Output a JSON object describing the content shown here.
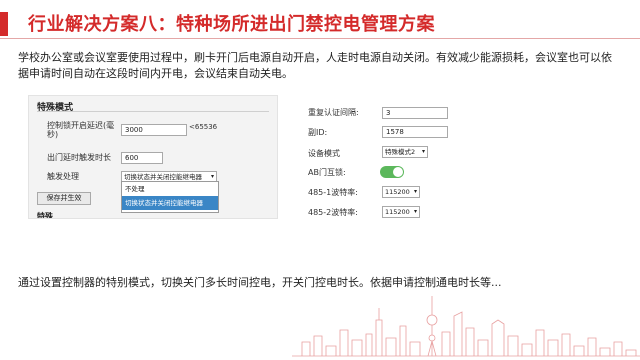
{
  "header": {
    "title": "行业解决方案八：特种场所进出门禁控电管理方案"
  },
  "intro": {
    "text": "学校办公室或会议室要使用过程中，刷卡开门后电源自动开启，人走时电源自动关闭。有效减少能源损耗，会议室也可以依据申请时间自动在这段时间内开电，会议结束自动关电。"
  },
  "special_mode": {
    "title": "特殊模式",
    "delay_label": "控制锁开启延迟(毫秒)",
    "delay_value": "3000",
    "delay_hint": "<65536",
    "exit_label": "出门延时触发时长",
    "exit_value": "600",
    "trigger_label": "触发处理",
    "trigger_selected": "切换状态并关闭控能继电器",
    "options": [
      "不处理",
      "切换状态并关闭控能继电器"
    ],
    "save_label": "保存并生效",
    "cut_label": "特殊"
  },
  "right_panel": {
    "repeat_label": "重复认证间隔:",
    "repeat_value": "3",
    "sn_label": "副ID:",
    "sn_value": "1578",
    "mode_label": "设备模式",
    "mode_value": "特殊模式2",
    "ab_label": "AB门互锁:",
    "ab_on": true,
    "baud1_label": "485-1波特率:",
    "baud1_value": "115200",
    "baud2_label": "485-2波特率:",
    "baud2_value": "115200"
  },
  "summary": {
    "text": "通过设置控制器的特别模式，切换关门多长时间控电，开关门控电时长。依据申请控制通电时长等..."
  },
  "colors": {
    "accent": "#d42a2a",
    "selected_option": "#3a86c6",
    "toggle_on": "#5cb85c"
  }
}
